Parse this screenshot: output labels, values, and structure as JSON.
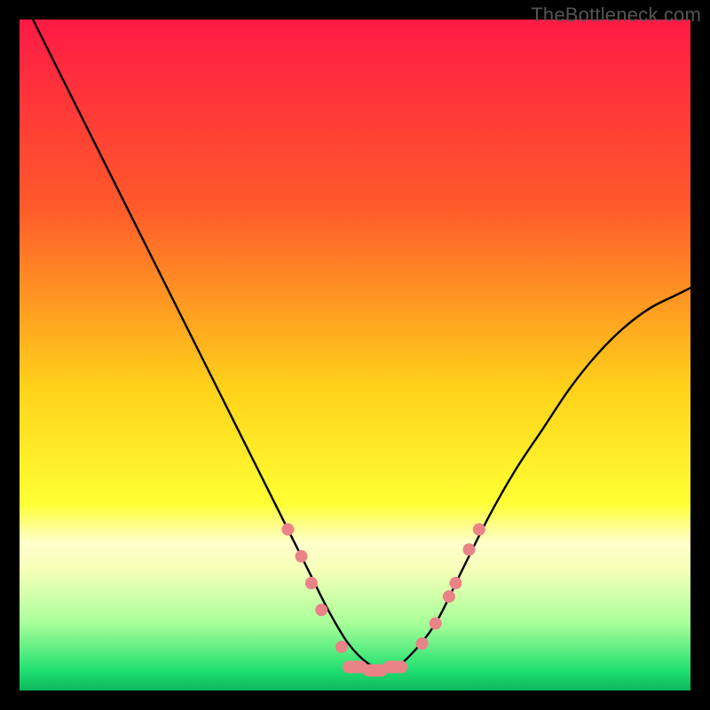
{
  "watermark": "TheBottleneck.com",
  "chart_data": {
    "type": "line",
    "title": "",
    "xlabel": "",
    "ylabel": "",
    "xlim": [
      0,
      100
    ],
    "ylim": [
      0,
      100
    ],
    "background_gradient_stops": [
      {
        "offset": 0.0,
        "color": "#ff1a45"
      },
      {
        "offset": 0.28,
        "color": "#ff5a2a"
      },
      {
        "offset": 0.55,
        "color": "#ffd21a"
      },
      {
        "offset": 0.72,
        "color": "#ffff33"
      },
      {
        "offset": 0.78,
        "color": "#ffffcc"
      },
      {
        "offset": 0.82,
        "color": "#f6ffb8"
      },
      {
        "offset": 0.9,
        "color": "#a8ff99"
      },
      {
        "offset": 0.97,
        "color": "#20e070"
      },
      {
        "offset": 1.0,
        "color": "#0db75c"
      }
    ],
    "series": [
      {
        "name": "bottleneck-curve",
        "color": "#000000",
        "x": [
          2,
          6,
          10,
          14,
          18,
          22,
          26,
          30,
          34,
          37,
          40,
          43,
          46,
          49,
          52,
          55,
          58,
          62,
          66,
          70,
          74,
          78,
          82,
          86,
          90,
          94,
          98,
          100
        ],
        "y": [
          100,
          92,
          84,
          76,
          68,
          60,
          52,
          44,
          36,
          30,
          24,
          18,
          12,
          7,
          4,
          3,
          5,
          10,
          18,
          26,
          33,
          39,
          45,
          50,
          54,
          57,
          59,
          60
        ]
      }
    ],
    "markers": {
      "name": "highlight-points",
      "shape": "rounded-rect",
      "color": "#e98387",
      "points": [
        {
          "x": 40,
          "y": 24
        },
        {
          "x": 42,
          "y": 20
        },
        {
          "x": 43.5,
          "y": 16
        },
        {
          "x": 45,
          "y": 12
        },
        {
          "x": 48,
          "y": 6.5
        },
        {
          "x": 50,
          "y": 3.5,
          "wide": true
        },
        {
          "x": 53,
          "y": 3,
          "wide": true
        },
        {
          "x": 56,
          "y": 3.5,
          "wide": true
        },
        {
          "x": 60,
          "y": 7
        },
        {
          "x": 62,
          "y": 10
        },
        {
          "x": 64,
          "y": 14
        },
        {
          "x": 65,
          "y": 16
        },
        {
          "x": 67,
          "y": 21
        },
        {
          "x": 68.5,
          "y": 24
        }
      ]
    }
  }
}
